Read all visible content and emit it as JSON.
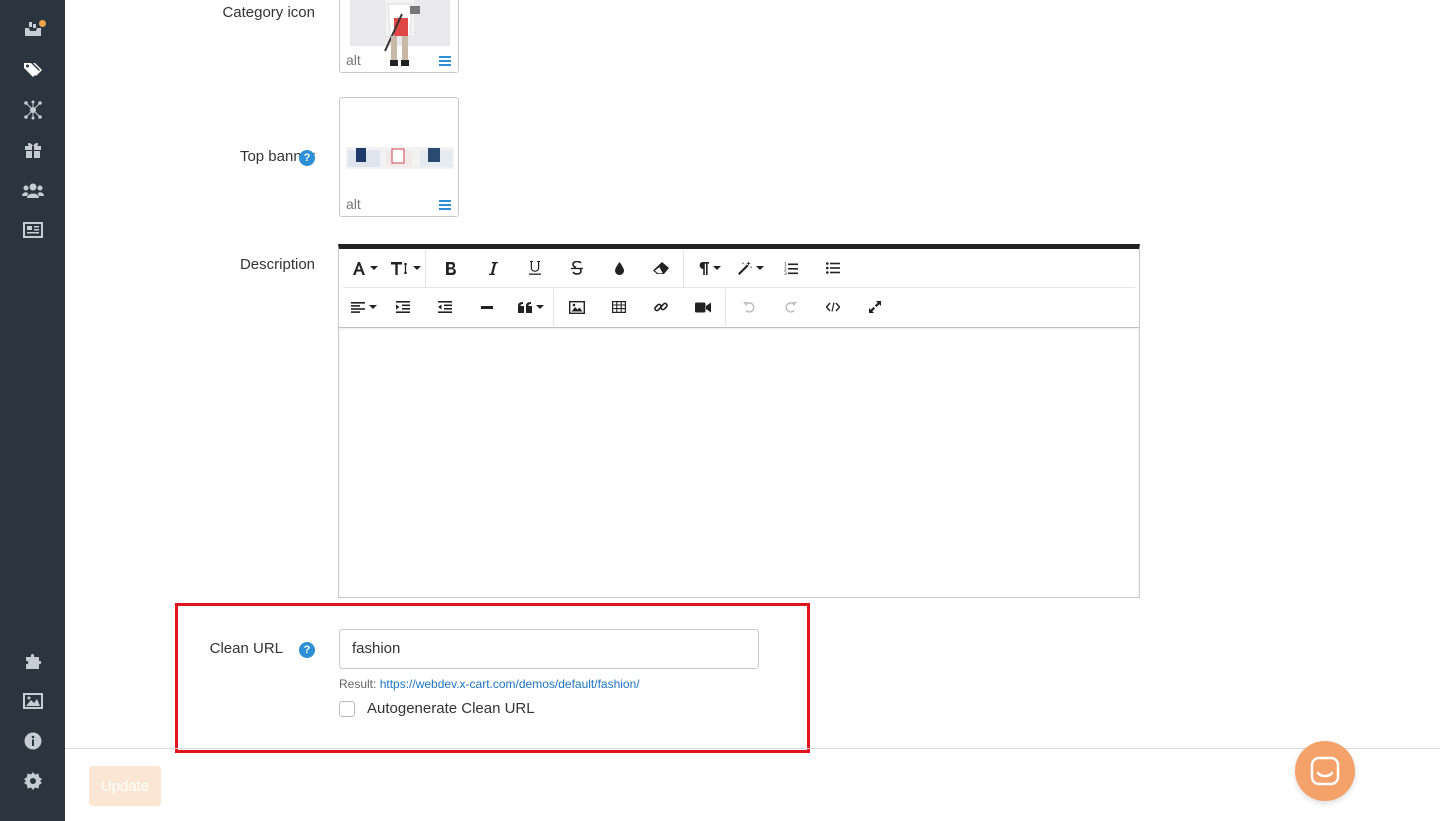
{
  "sidebar": {
    "items": [
      {
        "icon": "orders-icon",
        "active": false
      },
      {
        "icon": "tags-icon",
        "active": true
      },
      {
        "icon": "network-icon",
        "active": false
      },
      {
        "icon": "gift-icon",
        "active": false
      },
      {
        "icon": "users-icon",
        "active": false
      },
      {
        "icon": "newspaper-icon",
        "active": false
      },
      {
        "icon": "puzzle-icon",
        "active": false
      },
      {
        "icon": "image-icon",
        "active": false
      },
      {
        "icon": "info-icon",
        "active": false
      },
      {
        "icon": "gear-icon",
        "active": false
      }
    ]
  },
  "form": {
    "category_icon_label": "Category icon",
    "category_icon_alt": "alt",
    "top_banner_label": "Top banner",
    "top_banner_alt": "alt",
    "description_label": "Description",
    "clean_url_label": "Clean URL",
    "clean_url_value": "fashion",
    "result_prefix": "Result:",
    "result_url": "https://webdev.x-cart.com/demos/default/fashion/",
    "autogenerate_label": "Autogenerate Clean URL",
    "autogenerate_checked": false
  },
  "editor": {
    "toolbar_row1": [
      "font-family",
      "font-size",
      "bold",
      "italic",
      "underline",
      "strikethrough",
      "color",
      "clear-format",
      "paragraph",
      "style",
      "ordered-list",
      "unordered-list"
    ],
    "toolbar_row2": [
      "align",
      "indent",
      "outdent",
      "horizontal-rule",
      "quote",
      "insert-image",
      "insert-table",
      "insert-link",
      "insert-video",
      "undo",
      "redo",
      "code-view",
      "fullscreen"
    ],
    "content": ""
  },
  "footer": {
    "update_label": "Update"
  },
  "colors": {
    "sidebar_bg": "#2a3540",
    "accent_blue": "#2d8fd5",
    "highlight_red": "#e0161e",
    "update_disabled": "#fbe6d4",
    "chat_orange": "#f5a16a"
  }
}
